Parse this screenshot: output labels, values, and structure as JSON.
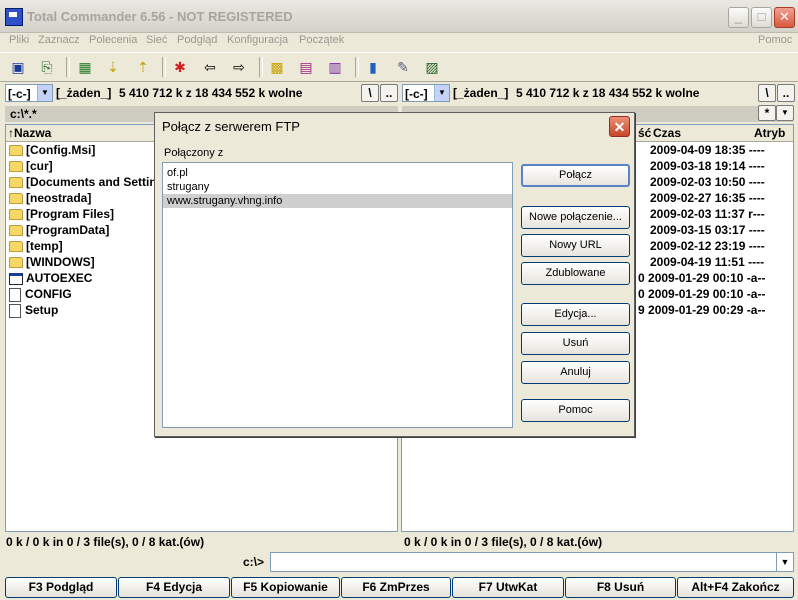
{
  "window": {
    "title": "Total Commander 6.56 - NOT REGISTERED"
  },
  "menu": [
    "Pliki",
    "Zaznacz",
    "Polecenia",
    "Sieć",
    "Podgląd",
    "Konfiguracja",
    "Początek"
  ],
  "menu_help": "Pomoc",
  "left": {
    "drive": "[-c-]",
    "free_label": "[_żaden_]",
    "free_text": "5 410 712 k z 18 434 552 k wolne",
    "path": "c:\\*.*",
    "col_name": "↑Nazwa",
    "files": [
      {
        "name": "[Config.Msi]",
        "type": "folder"
      },
      {
        "name": "[cur]",
        "type": "folder"
      },
      {
        "name": "[Documents and Settings]",
        "type": "folder"
      },
      {
        "name": "[neostrada]",
        "type": "folder"
      },
      {
        "name": "[Program Files]",
        "type": "folder"
      },
      {
        "name": "[ProgramData]",
        "type": "folder"
      },
      {
        "name": "[temp]",
        "type": "folder"
      },
      {
        "name": "[WINDOWS]",
        "type": "folder"
      },
      {
        "name": "AUTOEXEC",
        "type": "exe"
      },
      {
        "name": "CONFIG",
        "type": "file"
      },
      {
        "name": "Setup",
        "type": "file"
      }
    ],
    "status": "0 k / 0 k in 0 / 3 file(s), 0 / 8 kat.(ów)"
  },
  "right": {
    "drive": "[-c-]",
    "free_label": "[_żaden_]",
    "free_text": "5 410 712 k z 18 434 552 k wolne",
    "col_size": "ść",
    "col_date": "Czas",
    "col_attr": "Atryb",
    "rows": [
      {
        "prefix": "",
        "date": "2009-04-09 18:35",
        "attr": "----"
      },
      {
        "prefix": "",
        "date": "2009-03-18 19:14",
        "attr": "----"
      },
      {
        "prefix": "",
        "date": "2009-02-03 10:50",
        "attr": "----"
      },
      {
        "prefix": "",
        "date": "2009-02-27 16:35",
        "attr": "----"
      },
      {
        "prefix": "",
        "date": "2009-02-03 11:37",
        "attr": "r---"
      },
      {
        "prefix": "",
        "date": "2009-03-15 03:17",
        "attr": "----"
      },
      {
        "prefix": "",
        "date": "2009-02-12 23:19",
        "attr": "----"
      },
      {
        "prefix": "",
        "date": "2009-04-19 11:51",
        "attr": "----"
      },
      {
        "prefix": "0",
        "date": "2009-01-29 00:10",
        "attr": "-a--"
      },
      {
        "prefix": "0",
        "date": "2009-01-29 00:10",
        "attr": "-a--"
      },
      {
        "prefix": "9",
        "date": "2009-01-29 00:29",
        "attr": "-a--"
      }
    ],
    "status": "0 k / 0 k in 0 / 3 file(s), 0 / 8 kat.(ów)"
  },
  "cmdline": {
    "label": "c:\\>",
    "value": ""
  },
  "fkeys": [
    "F3 Podgląd",
    "F4 Edycja",
    "F5 Kopiowanie",
    "F6 ZmPrzes",
    "F7 UtwKat",
    "F8 Usuń",
    "Alt+F4 Zakończ"
  ],
  "dialog": {
    "title": "Połącz z serwerem FTP",
    "list_label": "Połączony z",
    "list": [
      "of.pl",
      "strugany",
      "www.strugany.vhng.info"
    ],
    "selected_index": 2,
    "buttons": {
      "connect": "Połącz",
      "new_connection": "Nowe połączenie...",
      "new_url": "Nowy URL",
      "duplicate": "Zdublowane",
      "edit": "Edycja...",
      "delete": "Usuń",
      "cancel": "Anuluj",
      "help": "Pomoc"
    }
  }
}
